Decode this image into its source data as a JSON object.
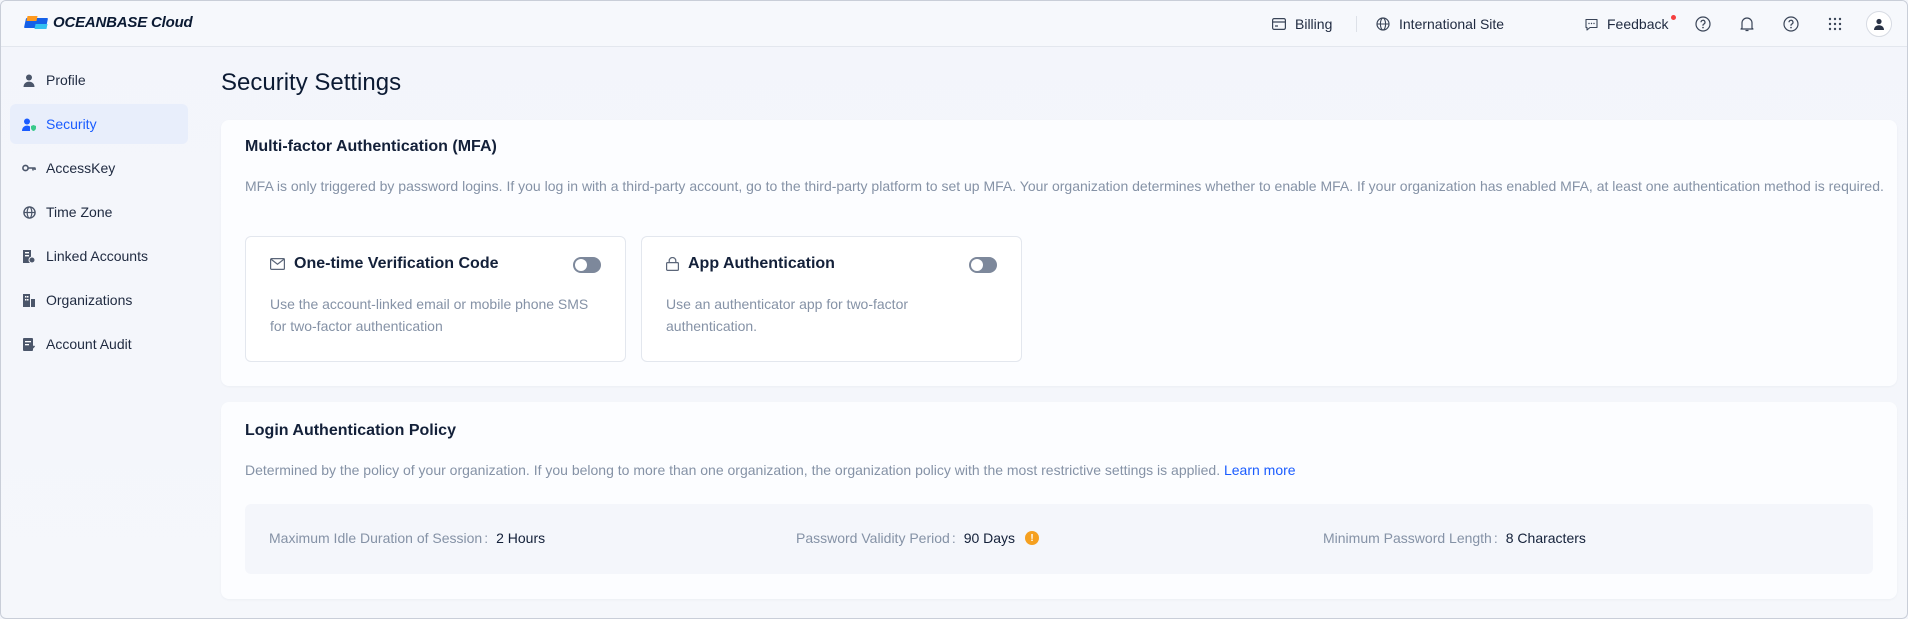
{
  "app": {
    "logo_text": "OCEANBASE Cloud"
  },
  "topbar": {
    "billing": "Billing",
    "site": "International Site",
    "feedback": "Feedback"
  },
  "sidebar": {
    "items": [
      {
        "label": "Profile",
        "icon": "user-icon"
      },
      {
        "label": "Security",
        "icon": "security-user-icon",
        "active": true
      },
      {
        "label": "AccessKey",
        "icon": "key-icon"
      },
      {
        "label": "Time Zone",
        "icon": "globe-icon"
      },
      {
        "label": "Linked Accounts",
        "icon": "linked-accounts-icon"
      },
      {
        "label": "Organizations",
        "icon": "organization-icon"
      },
      {
        "label": "Account Audit",
        "icon": "audit-icon"
      }
    ]
  },
  "page": {
    "title": "Security Settings"
  },
  "mfa": {
    "title": "Multi-factor Authentication (MFA)",
    "description": "MFA is only triggered by password logins. If you log in with a third-party account, go to the third-party platform to set up MFA. Your organization determines whether to enable MFA. If your organization has enabled MFA, at least one authentication method is required.",
    "methods": [
      {
        "name": "One-time Verification Code",
        "icon": "mail-icon",
        "description": "Use the account-linked email or mobile phone SMS for two-factor authentication",
        "enabled": false
      },
      {
        "name": "App Authentication",
        "icon": "lock-icon",
        "description": "Use an authenticator app for two-factor authentication.",
        "enabled": false
      }
    ]
  },
  "login_policy": {
    "title": "Login Authentication Policy",
    "description": "Determined by the policy of your organization. If you belong to more than one organization, the organization policy with the most restrictive settings is applied.",
    "learn_more": "Learn more",
    "colon": ":",
    "items": [
      {
        "label": "Maximum Idle Duration of Session",
        "value": "2 Hours"
      },
      {
        "label": "Password Validity Period",
        "value": "90 Days",
        "warning_icon": "warning-icon"
      },
      {
        "label": "Minimum Password Length",
        "value": "8 Characters"
      }
    ]
  },
  "colors": {
    "accent": "#1a5cff",
    "warning": "#f5a020",
    "notification_dot": "#f53f3f"
  }
}
